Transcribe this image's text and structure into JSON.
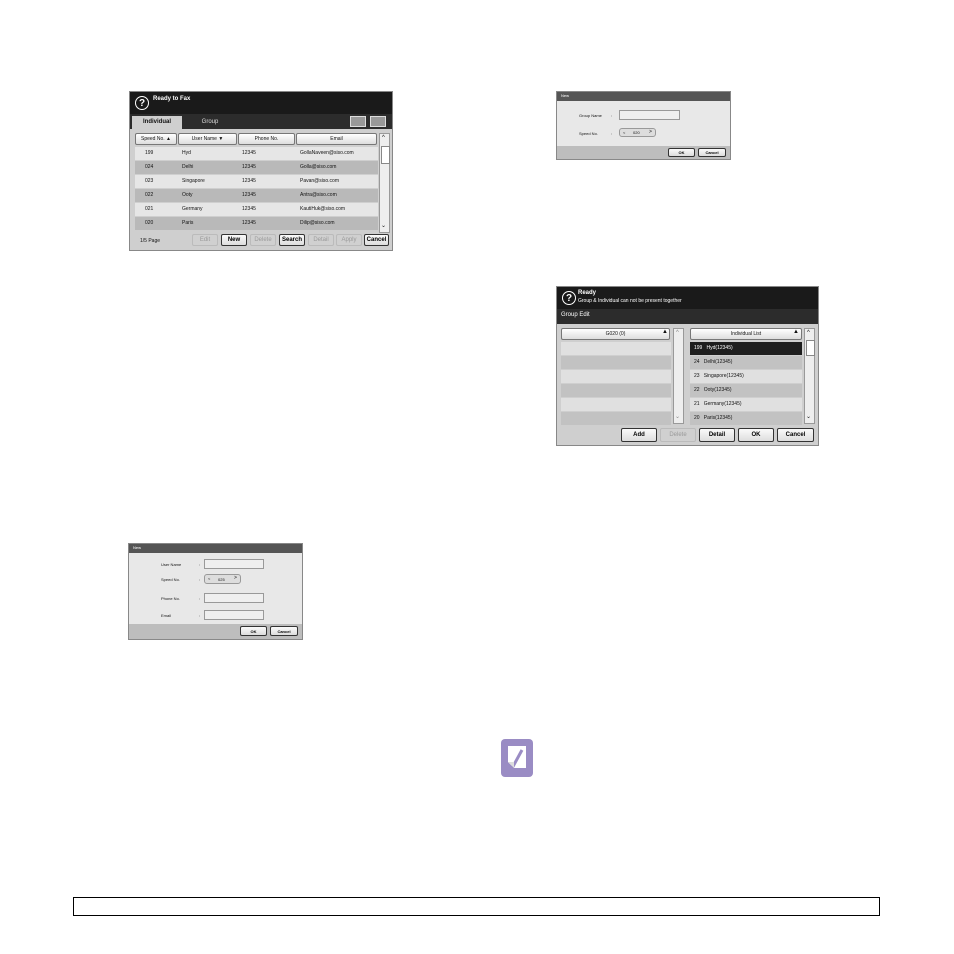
{
  "fax_list": {
    "status": "Ready to Fax",
    "tabs": [
      "Individual",
      "Group"
    ],
    "columns": [
      "Speed No.",
      "User Name",
      "Phone No.",
      "Email"
    ],
    "rows": [
      [
        "199",
        "Hyd",
        "12345",
        "GollaNaveen@siso.com"
      ],
      [
        "024",
        "Delhi",
        "12345",
        "Golla@siso.com"
      ],
      [
        "023",
        "Singapore",
        "12345",
        "Pavan@siso.com"
      ],
      [
        "022",
        "Ooty",
        "12345",
        "Antra@siso.com"
      ],
      [
        "021",
        "Germany",
        "12345",
        "KautiHuk@siso.com"
      ],
      [
        "020",
        "Paris",
        "12345",
        "Dilip@siso.com"
      ]
    ],
    "page": "1/5 Page",
    "buttons": [
      "Edit",
      "New",
      "Delete",
      "Search",
      "Detail",
      "Apply",
      "Cancel"
    ]
  },
  "new_group": {
    "title": "New",
    "group_name_label": "Group Name",
    "speed_label": "Speed No.",
    "speed_value": "020",
    "ok": "OK",
    "cancel": "Cancel"
  },
  "group_edit": {
    "status_line1": "Ready",
    "status_line2": "Group & Individual can not be present together",
    "title": "Group Edit",
    "left_header": "G020 (0)",
    "right_header": "Individual List",
    "items": [
      "199   Hyd(12345)",
      "24   Delhi(12345)",
      "23   Singapore(12345)",
      "22   Ooty(12345)",
      "21   Germany(12345)",
      "20   Paris(12345)"
    ],
    "buttons": [
      "Add",
      "Delete",
      "Detail",
      "OK",
      "Cancel"
    ]
  },
  "new_individual": {
    "title": "New",
    "user_label": "User Name",
    "speed_label": "Speed No.",
    "speed_value": "025",
    "phone_label": "Phone No.",
    "email_label": "Email",
    "ok": "OK",
    "cancel": "Cancel"
  }
}
